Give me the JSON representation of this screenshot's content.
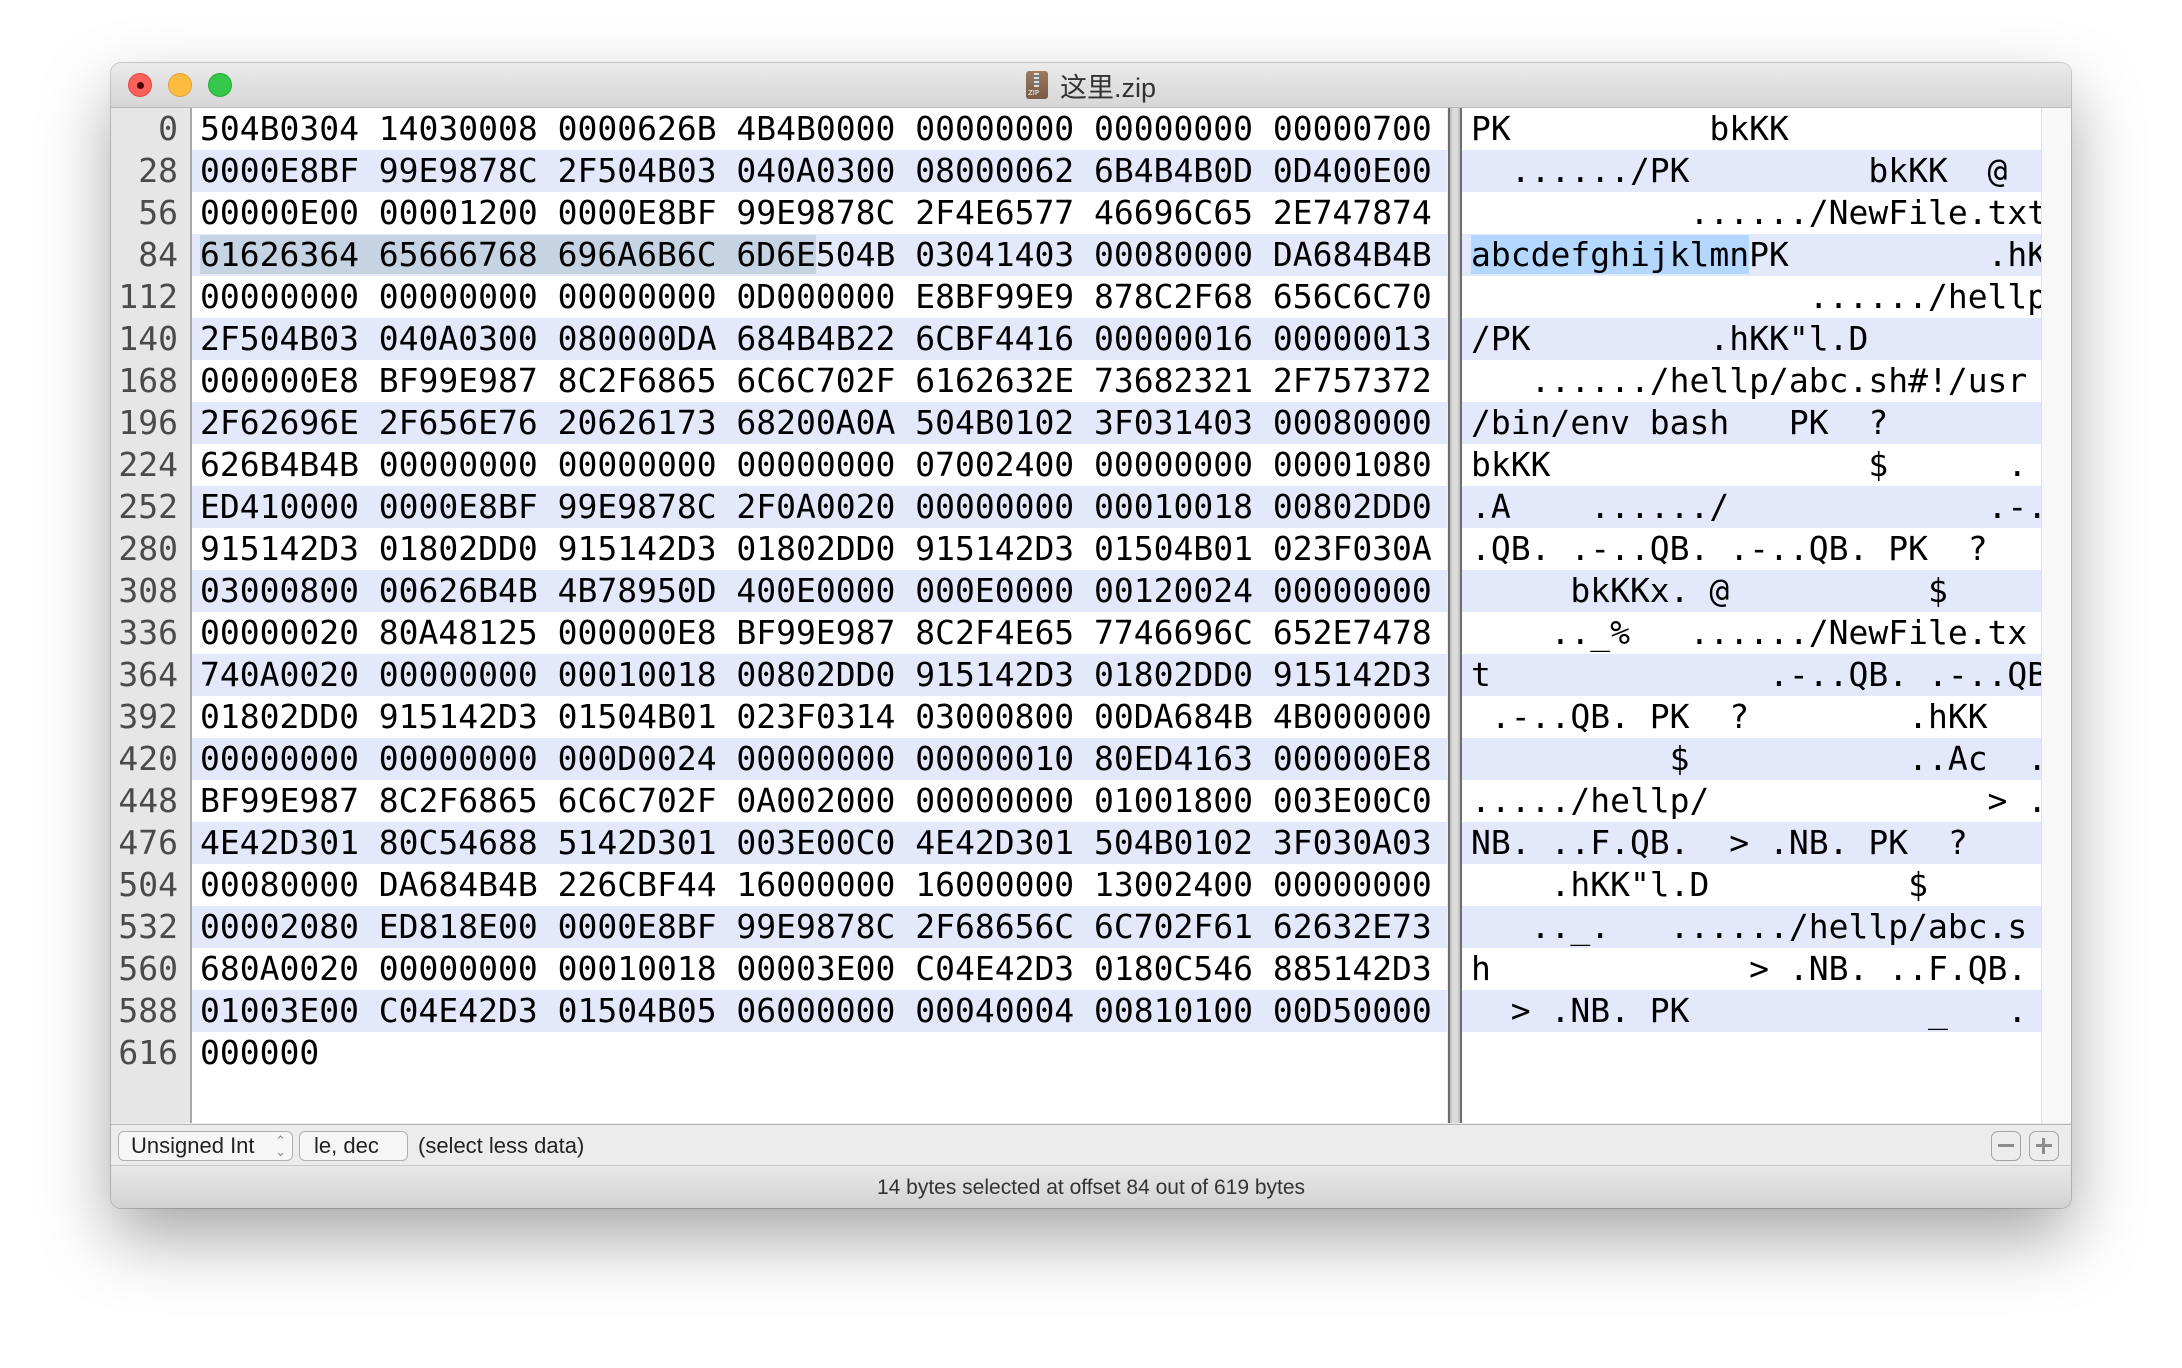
{
  "window": {
    "title": "这里.zip",
    "file_icon": "zip-archive-icon"
  },
  "hex_view": {
    "bytes_per_row": 28,
    "selection": {
      "offset": 84,
      "length": 14,
      "row_index": 3,
      "hex_chars_selected": 28,
      "ascii_text_selected": "abcdefghijklmn"
    },
    "rows": [
      {
        "offset": "0",
        "hex": "504B0304 14030008 0000626B 4B4B0000 00000000 00000000 00000700",
        "ascii": "PK          bkKK            "
      },
      {
        "offset": "28",
        "hex": "0000E8BF 99E9878C 2F504B03 040A0300 08000062 6B4B4B0D 0D400E00",
        "ascii": "  ....../PK         bkKK  @ "
      },
      {
        "offset": "56",
        "hex": "00000E00 00001200 0000E8BF 99E9878C 2F4E6577 46696C65 2E747874",
        "ascii": "           ....../NewFile.txt"
      },
      {
        "offset": "84",
        "hex": "61626364 65666768 696A6B6C 6D6E504B 03041403 00080000 DA684B4B",
        "ascii": "abcdefghijklmnPK          .hKK"
      },
      {
        "offset": "112",
        "hex": "00000000 00000000 00000000 0D000000 E8BF99E9 878C2F68 656C6C70",
        "ascii": "                 ....../hellp"
      },
      {
        "offset": "140",
        "hex": "2F504B03 040A0300 080000DA 684B4B22 6CBF4416 00000016 00000013",
        "ascii": "/PK         .hKK\"l.D        "
      },
      {
        "offset": "168",
        "hex": "000000E8 BF99E987 8C2F6865 6C6C702F 6162632E 73682321 2F757372",
        "ascii": "   ....../hellp/abc.sh#!/usr"
      },
      {
        "offset": "196",
        "hex": "2F62696E 2F656E76 20626173 68200A0A 504B0102 3F031403 00080000",
        "ascii": "/bin/env bash   PK  ?       "
      },
      {
        "offset": "224",
        "hex": "626B4B4B 00000000 00000000 00000000 07002400 00000000 00001080",
        "ascii": "bkKK                $      ."
      },
      {
        "offset": "252",
        "hex": "ED410000 0000E8BF 99E9878C 2F0A0020 00000000 00010018 00802DD0",
        "ascii": ".A    ....../             .-."
      },
      {
        "offset": "280",
        "hex": "915142D3 01802DD0 915142D3 01802DD0 915142D3 01504B01 023F030A",
        "ascii": ".QB. .-..QB. .-..QB. PK  ?  "
      },
      {
        "offset": "308",
        "hex": "03000800 00626B4B 4B78950D 400E0000 000E0000 00120024 00000000",
        "ascii": "     bkKKx. @          $    "
      },
      {
        "offset": "336",
        "hex": "00000020 80A48125 000000E8 BF99E987 8C2F4E65 7746696C 652E7478",
        "ascii": "    .._%   ....../NewFile.tx"
      },
      {
        "offset": "364",
        "hex": "740A0020 00000000 00010018 00802DD0 915142D3 01802DD0 915142D3",
        "ascii": "t              .-..QB. .-..QB."
      },
      {
        "offset": "392",
        "hex": "01802DD0 915142D3 01504B01 023F0314 03000800 00DA684B 4B000000",
        "ascii": " .-..QB. PK  ?        .hKK  "
      },
      {
        "offset": "420",
        "hex": "00000000 00000000 000D0024 00000000 00000010 80ED4163 000000E8",
        "ascii": "          $           ..Ac  ."
      },
      {
        "offset": "448",
        "hex": "BF99E987 8C2F6865 6C6C702F 0A002000 00000000 01001800 003E00C0",
        "ascii": "...../hellp/              > ."
      },
      {
        "offset": "476",
        "hex": "4E42D301 80C54688 5142D301 003E00C0 4E42D301 504B0102 3F030A03",
        "ascii": "NB. ..F.QB.  > .NB. PK  ?   "
      },
      {
        "offset": "504",
        "hex": "00080000 DA684B4B 226CBF44 16000000 16000000 13002400 00000000",
        "ascii": "    .hKK\"l.D          $     "
      },
      {
        "offset": "532",
        "hex": "00002080 ED818E00 0000E8BF 99E9878C 2F68656C 6C702F61 62632E73",
        "ascii": "   .._.   ....../hellp/abc.s"
      },
      {
        "offset": "560",
        "hex": "680A0020 00000000 00010018 00003E00 C04E42D3 0180C546 885142D3",
        "ascii": "h             > .NB. ..F.QB."
      },
      {
        "offset": "588",
        "hex": "01003E00 C04E42D3 01504B05 06000000 00040004 00810100 00D50000",
        "ascii": "  > .NB. PK            _   . "
      },
      {
        "offset": "616",
        "hex": "000000",
        "ascii": ""
      }
    ]
  },
  "inspector_bar": {
    "type_popup": {
      "selected": "Unsigned Int",
      "icon": "updown-chevron-icon"
    },
    "endian_popup": {
      "selected": "le, dec"
    },
    "hint": "(select less data)",
    "remove_button_icon": "minus-icon",
    "add_button_icon": "plus-icon"
  },
  "status_bar": {
    "text": "14 bytes selected at offset 84 out of 619 bytes"
  }
}
